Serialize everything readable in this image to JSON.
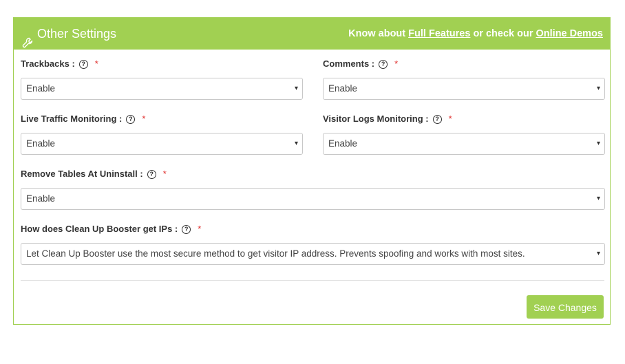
{
  "header": {
    "title": "Other Settings",
    "know_about": "Know about",
    "full_features": "Full Features",
    "or_check": "or check our",
    "online_demos": "Online Demos",
    "icon": "wrench-icon"
  },
  "fields": {
    "trackbacks": {
      "label": "Trackbacks :",
      "value": "Enable",
      "required": "*"
    },
    "comments": {
      "label": "Comments :",
      "value": "Enable",
      "required": "*"
    },
    "live_traffic": {
      "label": "Live Traffic Monitoring :",
      "value": "Enable",
      "required": "*"
    },
    "visitor_logs": {
      "label": "Visitor Logs Monitoring :",
      "value": "Enable",
      "required": "*"
    },
    "remove_tables": {
      "label": "Remove Tables At Uninstall :",
      "value": "Enable",
      "required": "*"
    },
    "get_ips": {
      "label": "How does Clean Up Booster get IPs :",
      "value": "Let Clean Up Booster use the most secure method to get visitor IP address. Prevents spoofing and works with most sites.",
      "required": "*"
    }
  },
  "help_glyph": "?",
  "arrow_glyph": "▾",
  "save_label": "Save Changes",
  "colors": {
    "accent": "#a1d052",
    "required": "#e0312f"
  }
}
